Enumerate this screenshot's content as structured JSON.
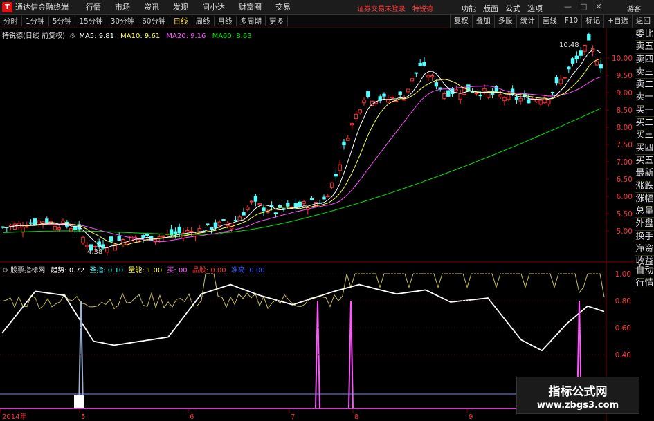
{
  "titlebar": {
    "app_title": "通达信金融终端",
    "menu": [
      "行情",
      "市场",
      "资讯",
      "发现",
      "问小达",
      "财富圈",
      "交易"
    ],
    "notice": "证券交易未登录",
    "stock_name_red": "特锐德",
    "right_menu": [
      "功能",
      "版面",
      "公式",
      "选项"
    ],
    "guest": "游客"
  },
  "periods": [
    "分时",
    "1分钟",
    "5分钟",
    "15分钟",
    "30分钟",
    "60分钟",
    "日线",
    "周线",
    "月线",
    "多周期",
    "更多"
  ],
  "active_period": "日线",
  "tools": [
    "复权",
    "叠加",
    "多股",
    "统计",
    "画线",
    "F10",
    "标记",
    "+自选",
    "返回"
  ],
  "main_chart": {
    "title": "特锐德(日线 前复权)",
    "ma5": "MA5: 9.81",
    "ma10": "MA10: 9.61",
    "ma20": "MA20: 9.16",
    "ma60": "MA60: 8.63",
    "high_label": "10.48",
    "low_label": "4.38",
    "y_ticks": [
      "10.00",
      "9.50",
      "9.00",
      "8.50",
      "8.00",
      "7.50",
      "7.00",
      "6.50",
      "6.00",
      "5.50",
      "5.00"
    ],
    "x_ticks": [
      "2014年",
      "5",
      "6",
      "7",
      "8",
      "9"
    ]
  },
  "indicator": {
    "name": "股票指标网",
    "trend": "趋势: 0.72",
    "sheng": "圣指: 0.10",
    "liangneng": "量能: 1.00",
    "buy": "买: 00",
    "pin": "品股: 0.00",
    "hide": "准高: 0.00",
    "y_ticks": [
      "1.00",
      "0.80",
      "0.60",
      "0.40"
    ]
  },
  "sidetabs": [
    "委比",
    "卖五",
    "卖四",
    "卖三",
    "卖二",
    "卖一",
    "买一",
    "买二",
    "买三",
    "买四",
    "买五",
    "最新",
    "涨跌",
    "涨幅",
    "总量",
    "外盘",
    "换手",
    "净资",
    "收益"
  ],
  "sidetabs2": [
    "自动",
    "行情"
  ],
  "watermark": {
    "line1": "指标公式网",
    "line2": "www.zbgs3.com"
  },
  "colors": {
    "up": "#ff3232",
    "down": "#54ffff",
    "ma5": "#ffffff",
    "ma10": "#ffff54",
    "ma20": "#ff54ff",
    "ma60": "#00e600"
  }
}
